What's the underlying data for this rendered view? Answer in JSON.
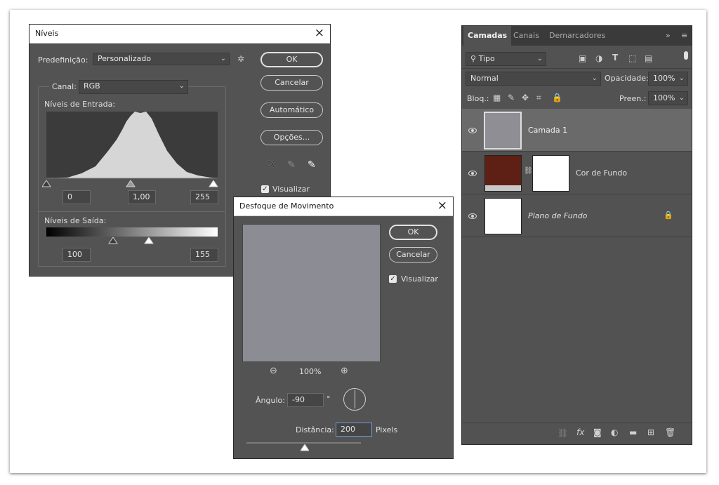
{
  "levels": {
    "title": "Níveis",
    "preset_label": "Predefinição:",
    "preset_value": "Personalizado",
    "channel_label": "Canal:",
    "channel_value": "RGB",
    "input_levels_label": "Níveis de Entrada:",
    "input_black": "0",
    "input_gamma": "1,00",
    "input_white": "255",
    "output_levels_label": "Níveis de Saída:",
    "output_black": "100",
    "output_white": "155",
    "ok": "OK",
    "cancel": "Cancelar",
    "auto": "Automático",
    "options": "Opções...",
    "preview": "Visualizar"
  },
  "motion_blur": {
    "title": "Desfoque de Movimento",
    "ok": "OK",
    "cancel": "Cancelar",
    "preview": "Visualizar",
    "zoom": "100%",
    "angle_label": "Ângulo:",
    "angle_value": "-90",
    "angle_unit": "°",
    "distance_label": "Distância:",
    "distance_value": "200",
    "distance_unit": "Pixels",
    "preview_color": "#8c8c94"
  },
  "layers_panel": {
    "tabs": [
      "Camadas",
      "Canais",
      "Demarcadores"
    ],
    "kind_filter": "Tipo",
    "blend_mode": "Normal",
    "opacity_label": "Opacidade:",
    "opacity_value": "100%",
    "lock_label": "Bloq.:",
    "fill_label": "Preen.:",
    "fill_value": "100%",
    "layers": [
      {
        "name": "Camada 1"
      },
      {
        "name": "Cor de Fundo",
        "color": "#5e2014"
      },
      {
        "name": "Plano de Fundo"
      }
    ]
  }
}
